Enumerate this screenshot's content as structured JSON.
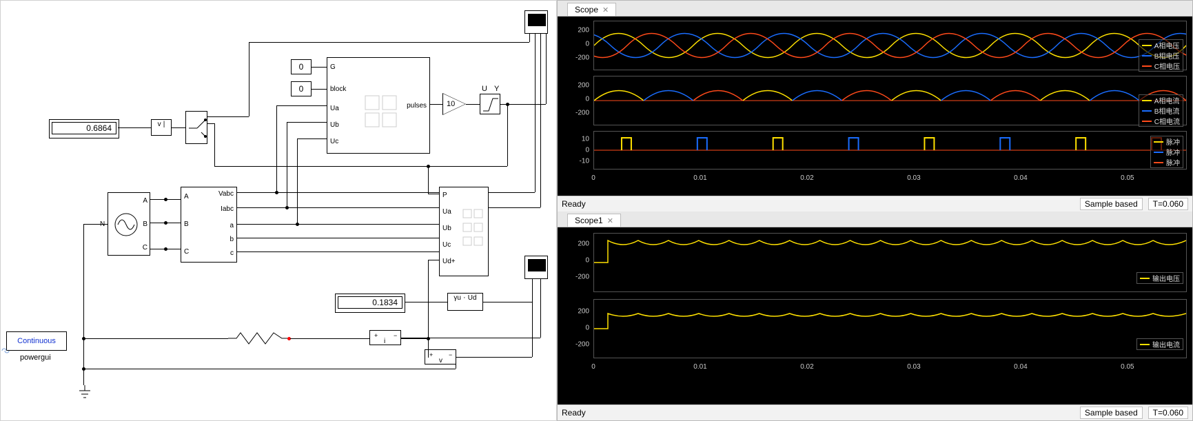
{
  "canvas": {
    "powergui_label": "Continuous",
    "powergui_name": "powergui",
    "display1": "0.6864",
    "display2": "0.1834",
    "const_g": "0",
    "const_block": "0",
    "gain_value": "10",
    "abs_in": "v",
    "abs_out": "|",
    "sat_in": "U",
    "sat_out": "Y",
    "meas_Vabc": "Vabc",
    "meas_Iabc": "Iabc",
    "meas_a": "a",
    "meas_b": "b",
    "meas_c": "c",
    "meas_A": "A",
    "meas_B": "B",
    "meas_C": "C",
    "src_A": "A",
    "src_B": "B",
    "src_C": "C",
    "src_N": "N",
    "pg_G": "G",
    "pg_block": "block",
    "pg_Ua": "Ua",
    "pg_Ub": "Ub",
    "pg_Uc": "Uc",
    "pg_out": "pulses",
    "conv_P": "P",
    "conv_Ua": "Ua",
    "conv_Ub": "Ub",
    "conv_Uc": "Uc",
    "conv_Udp": "Ud+",
    "rms_in": "γu",
    "rms_out": "Ud"
  },
  "scope": {
    "tab": "Scope",
    "status_left": "Ready",
    "status_mode": "Sample based",
    "status_time": "T=0.060",
    "plot1": {
      "yticks": [
        "200",
        "0",
        "-200"
      ],
      "legend": [
        "A相电压",
        "B相电压",
        "C相电压"
      ]
    },
    "plot2": {
      "yticks": [
        "200",
        "0",
        "-200"
      ],
      "legend": [
        "A相电流",
        "B相电流",
        "C相电流"
      ]
    },
    "plot3": {
      "yticks": [
        "10",
        "0",
        "-10"
      ],
      "legend": [
        "脉冲",
        "脉冲",
        "脉冲"
      ]
    },
    "xticks": [
      "0",
      "0.01",
      "0.02",
      "0.03",
      "0.04",
      "0.05"
    ]
  },
  "scope1": {
    "tab": "Scope1",
    "status_left": "Ready",
    "status_mode": "Sample based",
    "status_time": "T=0.060",
    "plot1": {
      "yticks": [
        "200",
        "0",
        "-200"
      ],
      "legend": [
        "输出电压"
      ]
    },
    "plot2": {
      "yticks": [
        "200",
        "0",
        "-200"
      ],
      "legend": [
        "输出电流"
      ]
    },
    "xticks": [
      "0",
      "0.01",
      "0.02",
      "0.03",
      "0.04",
      "0.05"
    ]
  },
  "colors": {
    "A": "#ffe100",
    "B": "#1a6dff",
    "C": "#ff4a1a",
    "grid": "#333"
  }
}
